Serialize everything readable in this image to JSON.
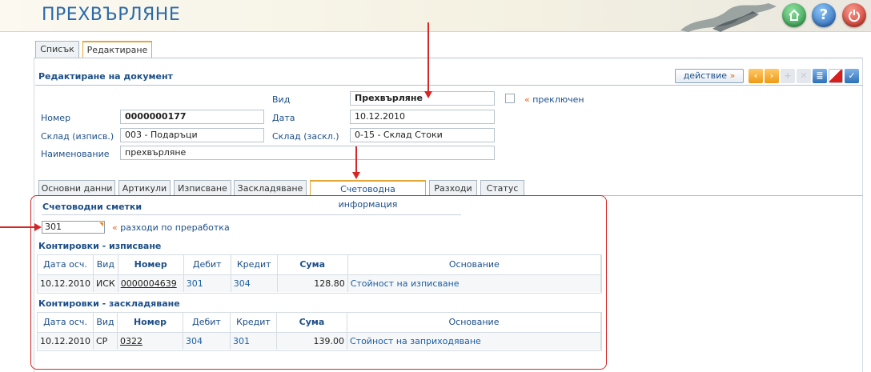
{
  "header": {
    "title": "ПРЕХВЪРЛЯНЕ"
  },
  "top_tabs": [
    {
      "label": "Списък"
    },
    {
      "label": "Редактиране"
    }
  ],
  "section": {
    "title": "Редактиране на документ"
  },
  "toolbar": {
    "action_label": "действие",
    "action_arrow": "»"
  },
  "form": {
    "type_label": "Вид",
    "type_value": "Прехвърляне",
    "switch_marker": "«",
    "switch_label": "преключен",
    "number_label": "Номер",
    "number_value": "0000000177",
    "date_label": "Дата",
    "date_value": "10.12.2010",
    "store_out_label": "Склад (изписв.)",
    "store_out_value": "003 - Подаръци",
    "store_in_label": "Склад (заскл.)",
    "store_in_value": "0-15 - Склад Стоки",
    "name_label": "Наименование",
    "name_value": "прехвърляне"
  },
  "sub_tabs": [
    {
      "label": "Основни данни"
    },
    {
      "label": "Артикули"
    },
    {
      "label": "Изписване"
    },
    {
      "label": "Заскладяване"
    },
    {
      "label": "Счетоводна информация"
    },
    {
      "label": "Разходи"
    },
    {
      "label": "Статус"
    }
  ],
  "accounting": {
    "title": "Счетоводни сметки",
    "account_value": "301",
    "account_marker": "«",
    "account_description": "разходи по преработка"
  },
  "writeoff": {
    "title": "Контировки - изписване",
    "columns": [
      "Дата осч.",
      "Вид",
      "Номер",
      "Дебит",
      "Кредит",
      "Сума",
      "Основание"
    ],
    "rows": [
      {
        "date": "10.12.2010",
        "type": "ИСК",
        "number": "0000004639",
        "debit": "301",
        "credit": "304",
        "sum": "128.80",
        "basis": "Стойност на изписване"
      }
    ]
  },
  "storage": {
    "title": "Контировки - заскладяване",
    "columns": [
      "Дата осч.",
      "Вид",
      "Номер",
      "Дебит",
      "Кредит",
      "Сума",
      "Основание"
    ],
    "rows": [
      {
        "date": "10.12.2010",
        "type": "СР",
        "number": "0322",
        "debit": "304",
        "credit": "301",
        "sum": "139.00",
        "basis": "Стойност на заприходяване"
      }
    ]
  }
}
